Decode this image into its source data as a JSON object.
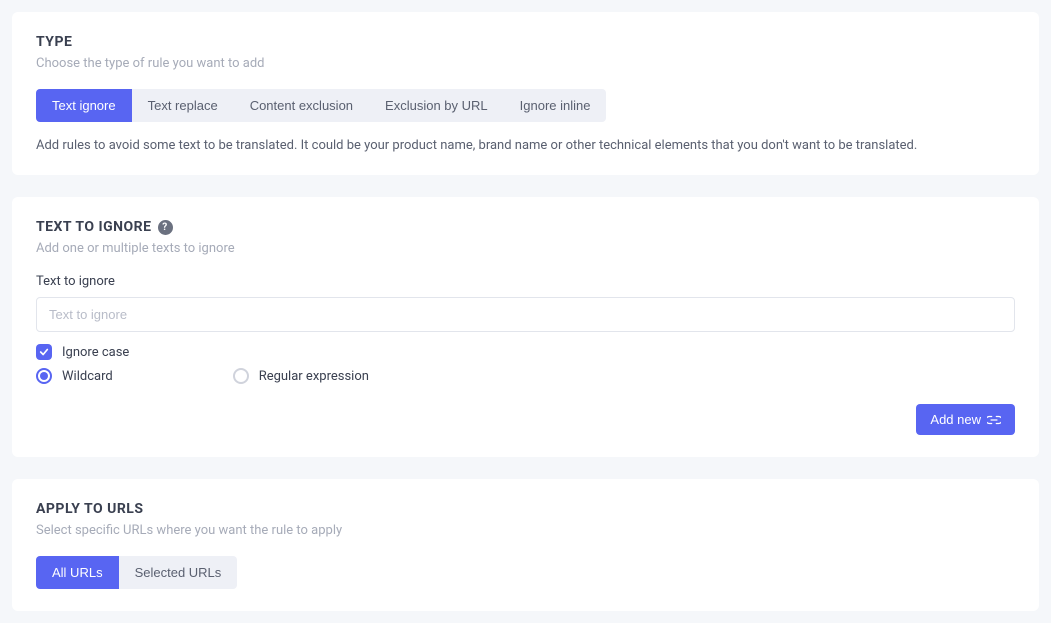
{
  "type_section": {
    "title": "TYPE",
    "subtitle": "Choose the type of rule you want to add",
    "tabs": {
      "text_ignore": "Text ignore",
      "text_replace": "Text replace",
      "content_exclusion": "Content exclusion",
      "exclusion_by_url": "Exclusion by URL",
      "ignore_inline": "Ignore inline"
    },
    "description": "Add rules to avoid some text to be translated. It could be your product name, brand name or other technical elements that you don't want to be translated."
  },
  "text_to_ignore_section": {
    "title": "TEXT TO IGNORE",
    "subtitle": "Add one or multiple texts to ignore",
    "field_label": "Text to ignore",
    "placeholder": "Text to ignore",
    "ignore_case_label": "Ignore case",
    "wildcard_label": "Wildcard",
    "regex_label": "Regular expression",
    "add_new_label": "Add new"
  },
  "apply_urls_section": {
    "title": "APPLY TO URLS",
    "subtitle": "Select specific URLs where you want the rule to apply",
    "tabs": {
      "all_urls": "All URLs",
      "selected_urls": "Selected URLs"
    }
  },
  "help_icon_text": "?"
}
